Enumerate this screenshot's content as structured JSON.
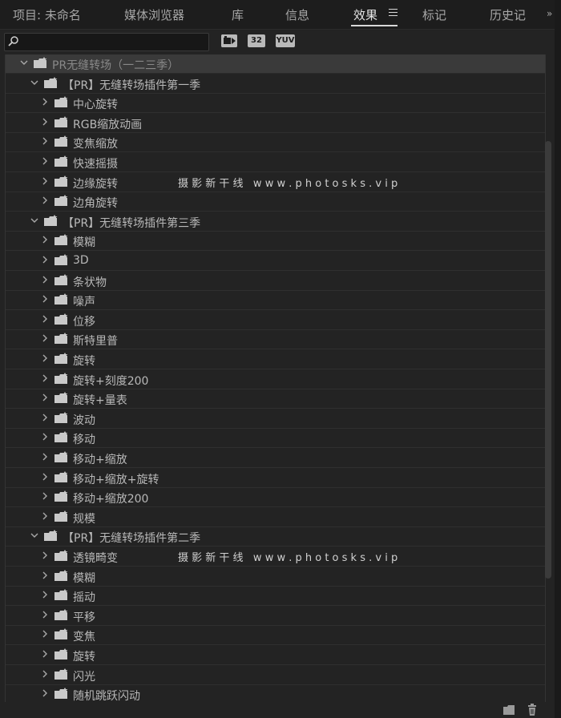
{
  "tabs": [
    {
      "label": "项目: 未命名",
      "active": false
    },
    {
      "label": "媒体浏览器",
      "active": false
    },
    {
      "label": "库",
      "active": false
    },
    {
      "label": "信息",
      "active": false
    },
    {
      "label": "效果",
      "active": true
    },
    {
      "label": "标记",
      "active": false
    },
    {
      "label": "历史记",
      "active": false
    }
  ],
  "overflow_label": "»",
  "search": {
    "value": "",
    "placeholder": ""
  },
  "filters": {
    "accelerated": "",
    "bit32": "32",
    "yuv": "YUV"
  },
  "tree": {
    "root": {
      "label": "PR无缝转场（一二三季）",
      "expanded": true
    },
    "groups": [
      {
        "label": "【PR】无缝转场插件第一季",
        "expanded": true,
        "items": [
          "中心旋转",
          "RGB缩放动画",
          "变焦缩放",
          "快速摇摄",
          "边缘旋转",
          "边角旋转"
        ]
      },
      {
        "label": "【PR】无缝转场插件第三季",
        "expanded": true,
        "items": [
          "模糊",
          "3D",
          "条状物",
          "噪声",
          "位移",
          "斯特里普",
          "旋转",
          "旋转+刻度200",
          "旋转+量表",
          "波动",
          "移动",
          "移动+缩放",
          "移动+缩放+旋转",
          "移动+缩放200",
          "规模"
        ]
      },
      {
        "label": "【PR】无缝转场插件第二季",
        "expanded": true,
        "items": [
          "透镜畸变",
          "模糊",
          "摇动",
          "平移",
          "变焦",
          "旋转",
          "闪光",
          "随机跳跃闪动"
        ]
      }
    ]
  },
  "watermarks": [
    {
      "text": "摄 影 新 干 线   w w w . p h o t o s k s . v i p"
    },
    {
      "text": "摄 影 新 干 线   w w w . p h o t o s k s . v i p"
    }
  ],
  "icons": {
    "search": "search-icon",
    "menu": "hamburger-menu-icon",
    "new_bin": "new-folder-icon",
    "delete": "trash-icon",
    "folder": "effects-folder-icon",
    "chevron": "chevron-icon"
  },
  "colors": {
    "background": "#232323",
    "tabbar": "#1d1d1d",
    "root_row": "#3a3a3a",
    "text": "#b8b8b8"
  }
}
